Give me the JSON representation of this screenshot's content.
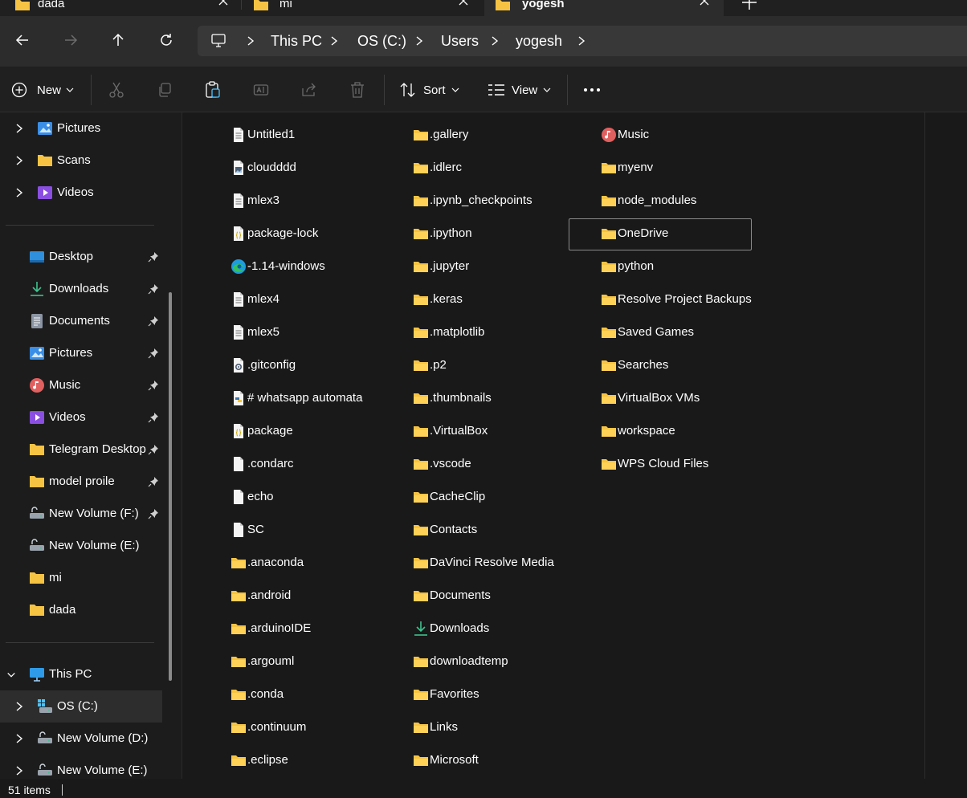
{
  "tabs": [
    {
      "label": "dada",
      "icon": "folder-icon",
      "active": false
    },
    {
      "label": "mi",
      "icon": "folder-icon",
      "active": false
    },
    {
      "label": "yogesh",
      "icon": "folder-icon",
      "active": true
    }
  ],
  "address": {
    "breadcrumbs": [
      "This PC",
      "OS (C:)",
      "Users",
      "yogesh"
    ]
  },
  "toolbar": {
    "new_label": "New",
    "sort_label": "Sort",
    "view_label": "View"
  },
  "sidebar": {
    "tree_top": [
      "Pictures",
      "Scans",
      "Videos"
    ],
    "quick_access": [
      {
        "label": "Desktop",
        "icon": "desktop-icon",
        "pinned": true
      },
      {
        "label": "Downloads",
        "icon": "downloads-icon",
        "pinned": true
      },
      {
        "label": "Documents",
        "icon": "documents-icon",
        "pinned": true
      },
      {
        "label": "Pictures",
        "icon": "pictures-icon",
        "pinned": true
      },
      {
        "label": "Music",
        "icon": "music-icon",
        "pinned": true
      },
      {
        "label": "Videos",
        "icon": "videos-icon",
        "pinned": true
      },
      {
        "label": "Telegram Desktop",
        "icon": "folder-icon",
        "pinned": true
      },
      {
        "label": "model proile",
        "icon": "folder-icon",
        "pinned": true
      },
      {
        "label": "New Volume (F:)",
        "icon": "drive-icon",
        "pinned": true
      },
      {
        "label": "New Volume (E:)",
        "icon": "drive-icon",
        "pinned": false
      },
      {
        "label": "mi",
        "icon": "folder-icon",
        "pinned": false
      },
      {
        "label": "dada",
        "icon": "folder-icon",
        "pinned": false
      }
    ],
    "this_pc_label": "This PC",
    "drives": [
      {
        "label": "OS (C:)",
        "selected": true
      },
      {
        "label": "New Volume (D:)",
        "selected": false
      },
      {
        "label": "New Volume (E:)",
        "selected": false
      }
    ]
  },
  "files": {
    "col1": [
      {
        "name": "Untitled1",
        "icon": "text-file-icon"
      },
      {
        "name": "cloudddd",
        "icon": "image-file-icon"
      },
      {
        "name": "mlex3",
        "icon": "text-file-icon"
      },
      {
        "name": "package-lock",
        "icon": "json-file-icon"
      },
      {
        "name": "-1.14-windows",
        "icon": "edge-icon"
      },
      {
        "name": "mlex4",
        "icon": "text-file-icon"
      },
      {
        "name": "mlex5",
        "icon": "text-file-icon"
      },
      {
        "name": ".gitconfig",
        "icon": "config-file-icon"
      },
      {
        "name": "# whatsapp automata",
        "icon": "python-file-icon"
      },
      {
        "name": "package",
        "icon": "json-file-icon"
      },
      {
        "name": ".condarc",
        "icon": "blank-file-icon"
      },
      {
        "name": "echo",
        "icon": "blank-file-icon"
      },
      {
        "name": "SC",
        "icon": "blank-file-icon"
      },
      {
        "name": ".anaconda",
        "icon": "folder-icon"
      },
      {
        "name": ".android",
        "icon": "folder-icon"
      },
      {
        "name": ".arduinoIDE",
        "icon": "folder-icon"
      },
      {
        "name": ".argouml",
        "icon": "folder-icon"
      },
      {
        "name": ".conda",
        "icon": "folder-icon"
      },
      {
        "name": ".continuum",
        "icon": "folder-icon"
      },
      {
        "name": ".eclipse",
        "icon": "folder-icon"
      }
    ],
    "col2": [
      {
        "name": ".gallery",
        "icon": "folder-icon"
      },
      {
        "name": ".idlerc",
        "icon": "folder-icon"
      },
      {
        "name": ".ipynb_checkpoints",
        "icon": "folder-icon"
      },
      {
        "name": ".ipython",
        "icon": "folder-icon"
      },
      {
        "name": ".jupyter",
        "icon": "folder-icon"
      },
      {
        "name": ".keras",
        "icon": "folder-icon"
      },
      {
        "name": ".matplotlib",
        "icon": "folder-icon"
      },
      {
        "name": ".p2",
        "icon": "folder-icon"
      },
      {
        "name": ".thumbnails",
        "icon": "folder-icon"
      },
      {
        "name": ".VirtualBox",
        "icon": "folder-icon"
      },
      {
        "name": ".vscode",
        "icon": "folder-icon"
      },
      {
        "name": "CacheClip",
        "icon": "folder-icon"
      },
      {
        "name": "Contacts",
        "icon": "folder-icon"
      },
      {
        "name": "DaVinci Resolve Media",
        "icon": "folder-icon"
      },
      {
        "name": "Documents",
        "icon": "folder-icon"
      },
      {
        "name": "Downloads",
        "icon": "downloads-icon"
      },
      {
        "name": "downloadtemp",
        "icon": "folder-icon"
      },
      {
        "name": "Favorites",
        "icon": "folder-icon"
      },
      {
        "name": "Links",
        "icon": "folder-icon"
      },
      {
        "name": "Microsoft",
        "icon": "folder-icon"
      }
    ],
    "col3": [
      {
        "name": "Music",
        "icon": "music-icon"
      },
      {
        "name": "myenv",
        "icon": "folder-icon"
      },
      {
        "name": "node_modules",
        "icon": "folder-icon"
      },
      {
        "name": "OneDrive",
        "icon": "folder-icon",
        "focused": true
      },
      {
        "name": "python",
        "icon": "folder-icon"
      },
      {
        "name": "Resolve Project Backups",
        "icon": "folder-icon"
      },
      {
        "name": "Saved Games",
        "icon": "folder-icon"
      },
      {
        "name": "Searches",
        "icon": "folder-icon"
      },
      {
        "name": "VirtualBox VMs",
        "icon": "folder-icon"
      },
      {
        "name": "workspace",
        "icon": "folder-icon"
      },
      {
        "name": "WPS Cloud Files",
        "icon": "folder-icon"
      }
    ]
  },
  "status": {
    "item_count": "51 items"
  },
  "colors": {
    "background": "#191919",
    "folder": "#f6c343",
    "accent": "#4cc2ff"
  }
}
